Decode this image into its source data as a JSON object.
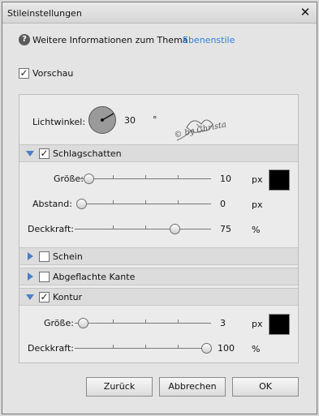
{
  "window": {
    "title": "Stileinstellungen"
  },
  "help": {
    "text": "Weitere Informationen zum Thema",
    "link": "Ebenenstile"
  },
  "preview": {
    "label": "Vorschau",
    "checked": true
  },
  "angle": {
    "label": "Lichtwinkel:",
    "value": "30",
    "unit": "°"
  },
  "watermark": {
    "text": "© by Christa"
  },
  "sections": {
    "schlagschatten": {
      "label": "Schlagschatten",
      "checked": true,
      "expanded": true
    },
    "schein": {
      "label": "Schein",
      "checked": false,
      "expanded": false
    },
    "kante": {
      "label": "Abgeflachte Kante",
      "checked": false,
      "expanded": false
    },
    "kontur": {
      "label": "Kontur",
      "checked": true,
      "expanded": true
    }
  },
  "shadow": {
    "size": {
      "label": "Größe:",
      "value": "10",
      "unit": "px"
    },
    "distance": {
      "label": "Abstand:",
      "value": "0",
      "unit": "px"
    },
    "opacity": {
      "label": "Deckkraft:",
      "value": "75",
      "unit": "%"
    },
    "color": "#000000"
  },
  "stroke": {
    "size": {
      "label": "Größe:",
      "value": "3",
      "unit": "px"
    },
    "opacity": {
      "label": "Deckkraft:",
      "value": "100",
      "unit": "%"
    },
    "color": "#000000"
  },
  "buttons": {
    "back": "Zurück",
    "cancel": "Abbrechen",
    "ok": "OK"
  }
}
